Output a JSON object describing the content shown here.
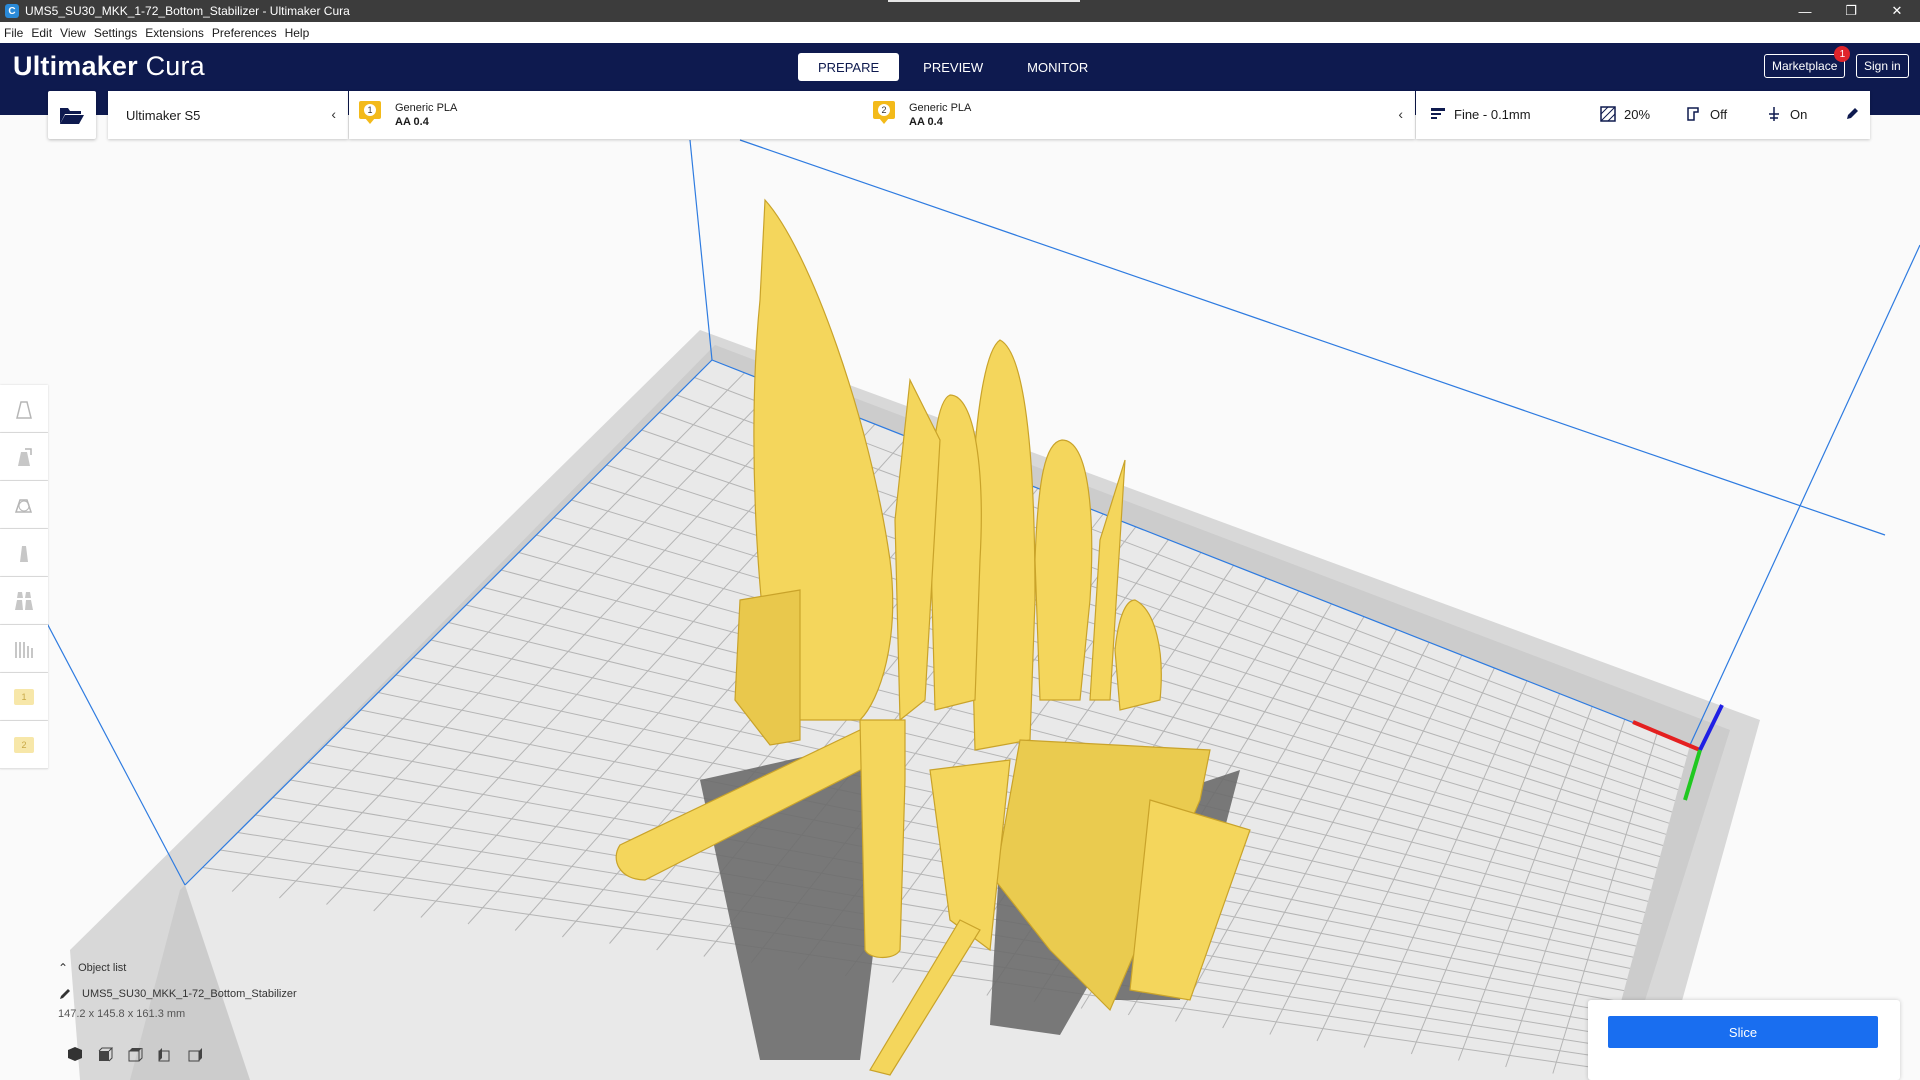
{
  "window": {
    "title": "UMS5_SU30_MKK_1-72_Bottom_Stabilizer - Ultimaker Cura",
    "app_icon": "C",
    "controls": [
      "minimize-icon",
      "restore-icon",
      "close-icon"
    ]
  },
  "menubar": {
    "items": [
      {
        "label": "File"
      },
      {
        "label": "Edit"
      },
      {
        "label": "View"
      },
      {
        "label": "Settings"
      },
      {
        "label": "Extensions"
      },
      {
        "label": "Preferences"
      },
      {
        "label": "Help"
      }
    ]
  },
  "header": {
    "logo_brand": "Ultimaker",
    "logo_product": "Cura",
    "tabs": [
      {
        "label": "PREPARE",
        "active": true
      },
      {
        "label": "PREVIEW",
        "active": false
      },
      {
        "label": "MONITOR",
        "active": false
      }
    ],
    "marketplace_label": "Marketplace",
    "marketplace_badge": "1",
    "signin_label": "Sign in"
  },
  "toolbar": {
    "open_icon": "folder-open-icon",
    "printer_name": "Ultimaker S5",
    "extruders": [
      {
        "number": "1",
        "material": "Generic PLA",
        "nozzle": "AA 0.4"
      },
      {
        "number": "2",
        "material": "Generic PLA",
        "nozzle": "AA 0.4"
      }
    ],
    "profile": "Fine - 0.1mm",
    "infill": "20%",
    "support": "Off",
    "adhesion": "On"
  },
  "tools": [
    "move-tool-icon",
    "scale-tool-icon",
    "rotate-tool-icon",
    "mirror-tool-icon",
    "per-model-settings-icon",
    "support-blocker-icon"
  ],
  "extruder_tools": [
    "1",
    "2"
  ],
  "object_list": {
    "header": "Object list",
    "object_name": "UMS5_SU30_MKK_1-72_Bottom_Stabilizer",
    "dimensions": "147.2 x 145.8 x 161.3 mm"
  },
  "view_buttons": [
    "3d-view-icon",
    "front-view-icon",
    "top-view-icon",
    "left-view-icon",
    "right-view-icon"
  ],
  "slice": {
    "label": "Slice"
  },
  "colors": {
    "header_bg": "#0e1a4f",
    "model_yellow": "#f4d65c",
    "slice_blue": "#196ef0",
    "build_volume_line": "#2e7be0"
  }
}
